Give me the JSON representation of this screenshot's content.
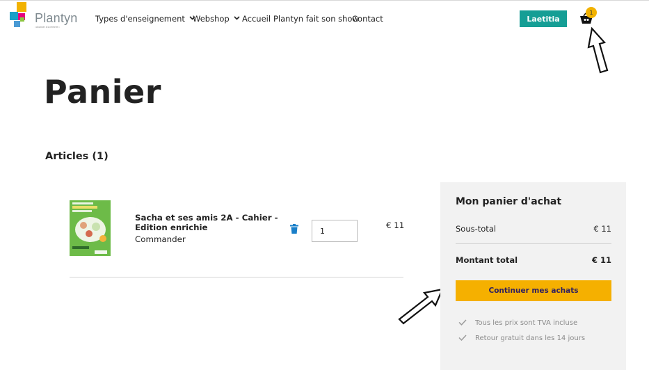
{
  "header": {
    "logo_text": "Plantyn",
    "logo_subtitle": "• Avancer à la rentrée •",
    "nav": [
      {
        "label": "Types d'enseignement",
        "has_dropdown": true
      },
      {
        "label": "Webshop",
        "has_dropdown": true
      },
      {
        "label": "Accueil",
        "has_dropdown": false
      },
      {
        "label": "Plantyn fait son show",
        "has_dropdown": false
      },
      {
        "label": "Contact",
        "has_dropdown": false
      }
    ],
    "user_button": "Laetitia",
    "cart_count": "1",
    "cart_icon": "basket-icon"
  },
  "page": {
    "title": "Panier",
    "articles_label": "Articles (1)"
  },
  "cart": {
    "items": [
      {
        "name": "Sacha et ses amis 2A - Cahier - Edition enrichie",
        "action": "Commander",
        "quantity": "1",
        "price": "€ 11"
      }
    ]
  },
  "summary": {
    "title": "Mon panier d'achat",
    "subtotal_label": "Sous-total",
    "subtotal_value": "€ 11",
    "total_label": "Montant total",
    "total_value": "€ 11",
    "continue_button": "Continuer mes achats",
    "info": [
      "Tous les prix sont TVA incluse",
      "Retour gratuit dans les 14 jours"
    ]
  },
  "colors": {
    "accent_teal": "#159e95",
    "accent_yellow": "#f5b000",
    "summary_bg": "#f2f2f2"
  }
}
